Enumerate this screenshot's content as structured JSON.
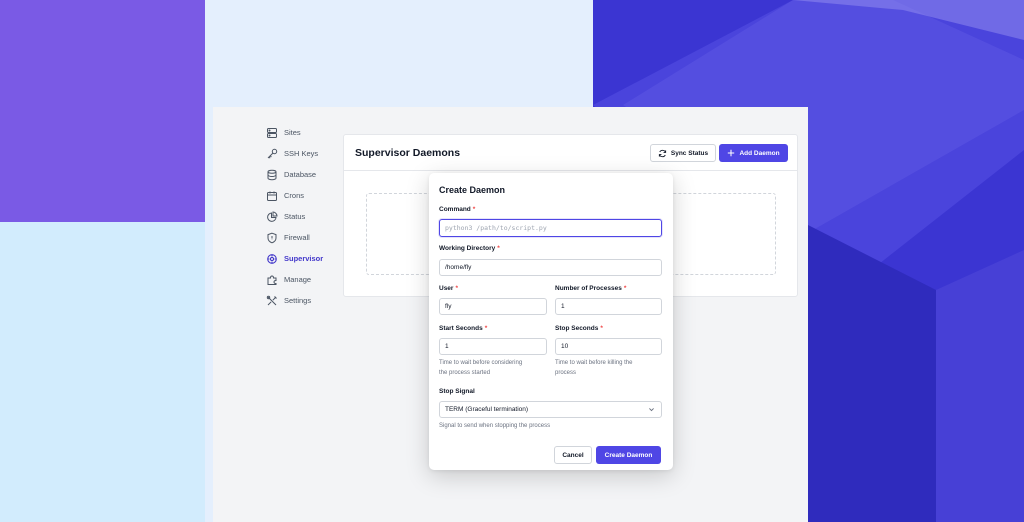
{
  "sidebar": {
    "items": [
      {
        "label": "Sites",
        "icon": "database-stack-icon"
      },
      {
        "label": "SSH Keys",
        "icon": "key-icon"
      },
      {
        "label": "Database",
        "icon": "database-icon"
      },
      {
        "label": "Crons",
        "icon": "calendar-icon"
      },
      {
        "label": "Status",
        "icon": "pie-chart-icon"
      },
      {
        "label": "Firewall",
        "icon": "shield-icon"
      },
      {
        "label": "Supervisor",
        "icon": "cog-icon"
      },
      {
        "label": "Manage",
        "icon": "puzzle-icon"
      },
      {
        "label": "Settings",
        "icon": "tools-icon"
      }
    ],
    "active": "Supervisor"
  },
  "main": {
    "title": "Supervisor Daemons",
    "sync_label": "Sync Status",
    "add_label": "Add Daemon"
  },
  "modal": {
    "title": "Create Daemon",
    "command": {
      "label": "Command",
      "placeholder": "python3 /path/to/script.py",
      "value": ""
    },
    "working_directory": {
      "label": "Working Directory",
      "value": "/home/fly"
    },
    "user": {
      "label": "User",
      "value": "fly"
    },
    "num_processes": {
      "label": "Number of Processes",
      "value": "1"
    },
    "start_seconds": {
      "label": "Start Seconds",
      "value": "1",
      "help_line1": "Time to wait before considering",
      "help_line2": "the process started"
    },
    "stop_seconds": {
      "label": "Stop Seconds",
      "value": "10",
      "help_line1": "Time to wait before killing the",
      "help_line2": "process"
    },
    "stop_signal": {
      "label": "Stop Signal",
      "value": "TERM (Graceful termination)",
      "help": "Signal to send when stopping the process"
    },
    "cancel_label": "Cancel",
    "create_label": "Create Daemon"
  },
  "colors": {
    "accent": "#4f46e5",
    "required": "#ef4444",
    "bg_purple": "#7a5ae5",
    "bg_blue": "#3b35d2"
  }
}
